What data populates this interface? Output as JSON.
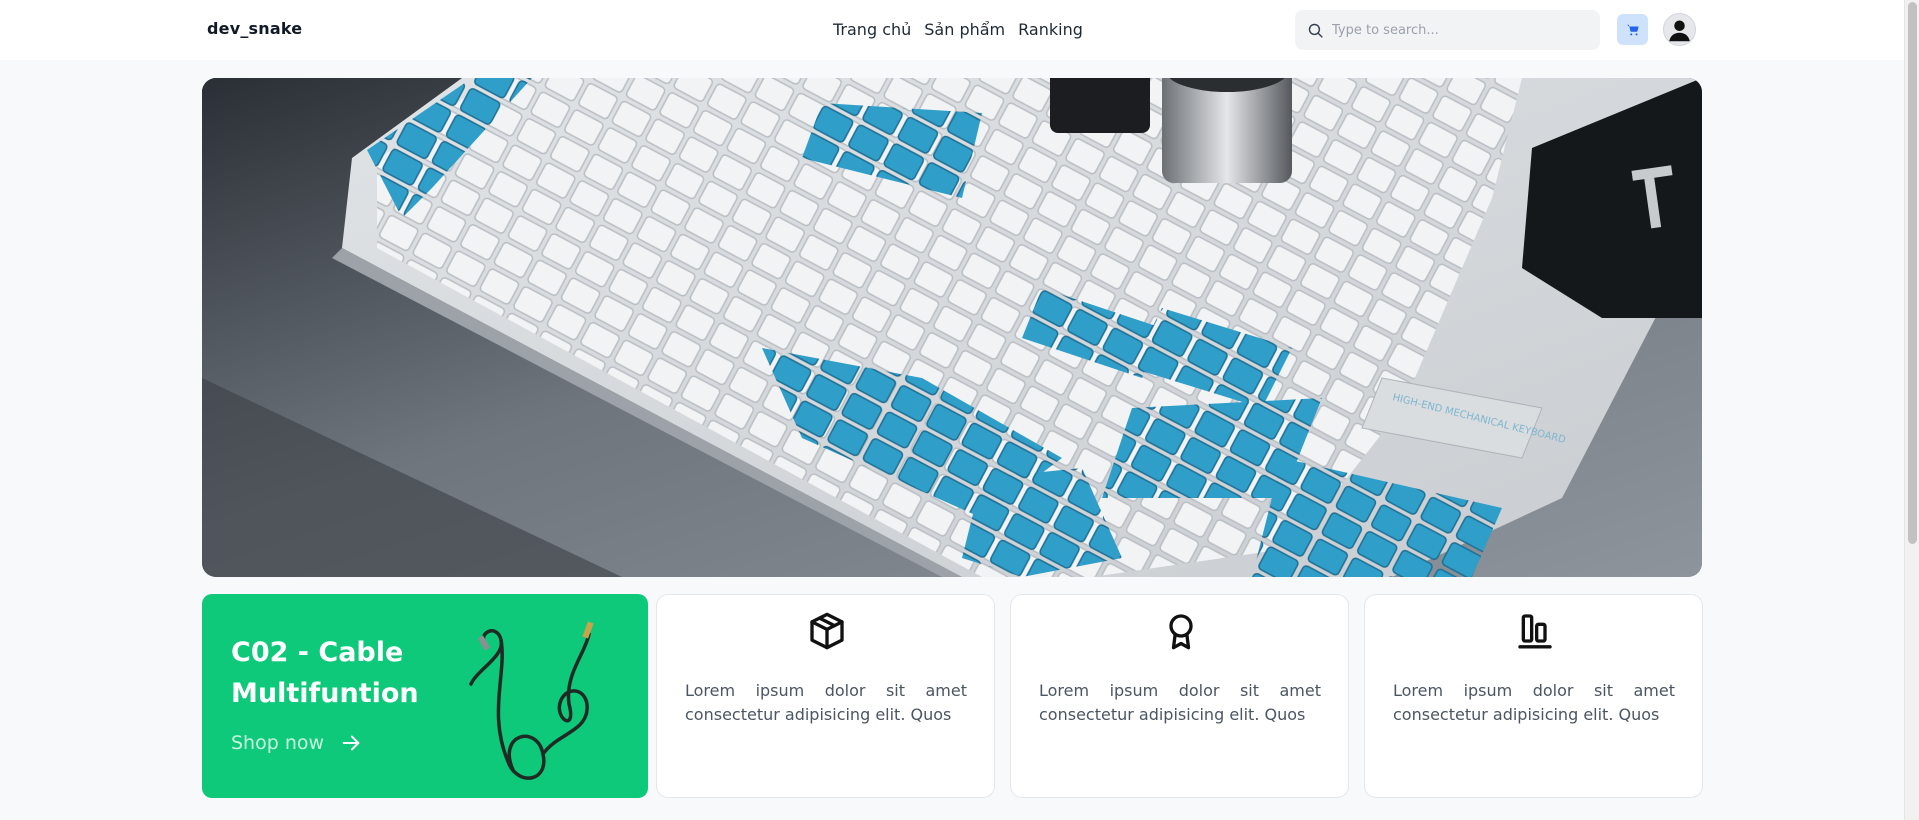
{
  "header": {
    "brand": "dev_snake",
    "nav": [
      {
        "label": "Trang chủ"
      },
      {
        "label": "Sản phẩm"
      },
      {
        "label": "Ranking"
      }
    ],
    "search": {
      "placeholder": "Type to search...",
      "value": "",
      "icon": "search-icon"
    },
    "cart_icon": "cart-icon",
    "avatar_icon": "user-icon",
    "accent": "#cfe2fb"
  },
  "hero": {
    "image": "mechanical-keyboard-photo",
    "keyboard_label": "HIGH-END MECHANICAL KEYBOARD"
  },
  "promo": {
    "title": "C02 - Cable Multifuntion",
    "cta": "Shop now",
    "cta_icon": "arrow-right-icon",
    "color": "#0ec97a"
  },
  "features": [
    {
      "icon": "box-icon",
      "text": "Lorem ipsum dolor sit amet consectetur adipisicing elit. Quos"
    },
    {
      "icon": "award-icon",
      "text": "Lorem ipsum dolor sit amet consectetur adipisicing elit. Quos"
    },
    {
      "icon": "bar-chart-icon",
      "text": "Lorem ipsum dolor sit amet consectetur adipisicing elit. Quos"
    }
  ]
}
